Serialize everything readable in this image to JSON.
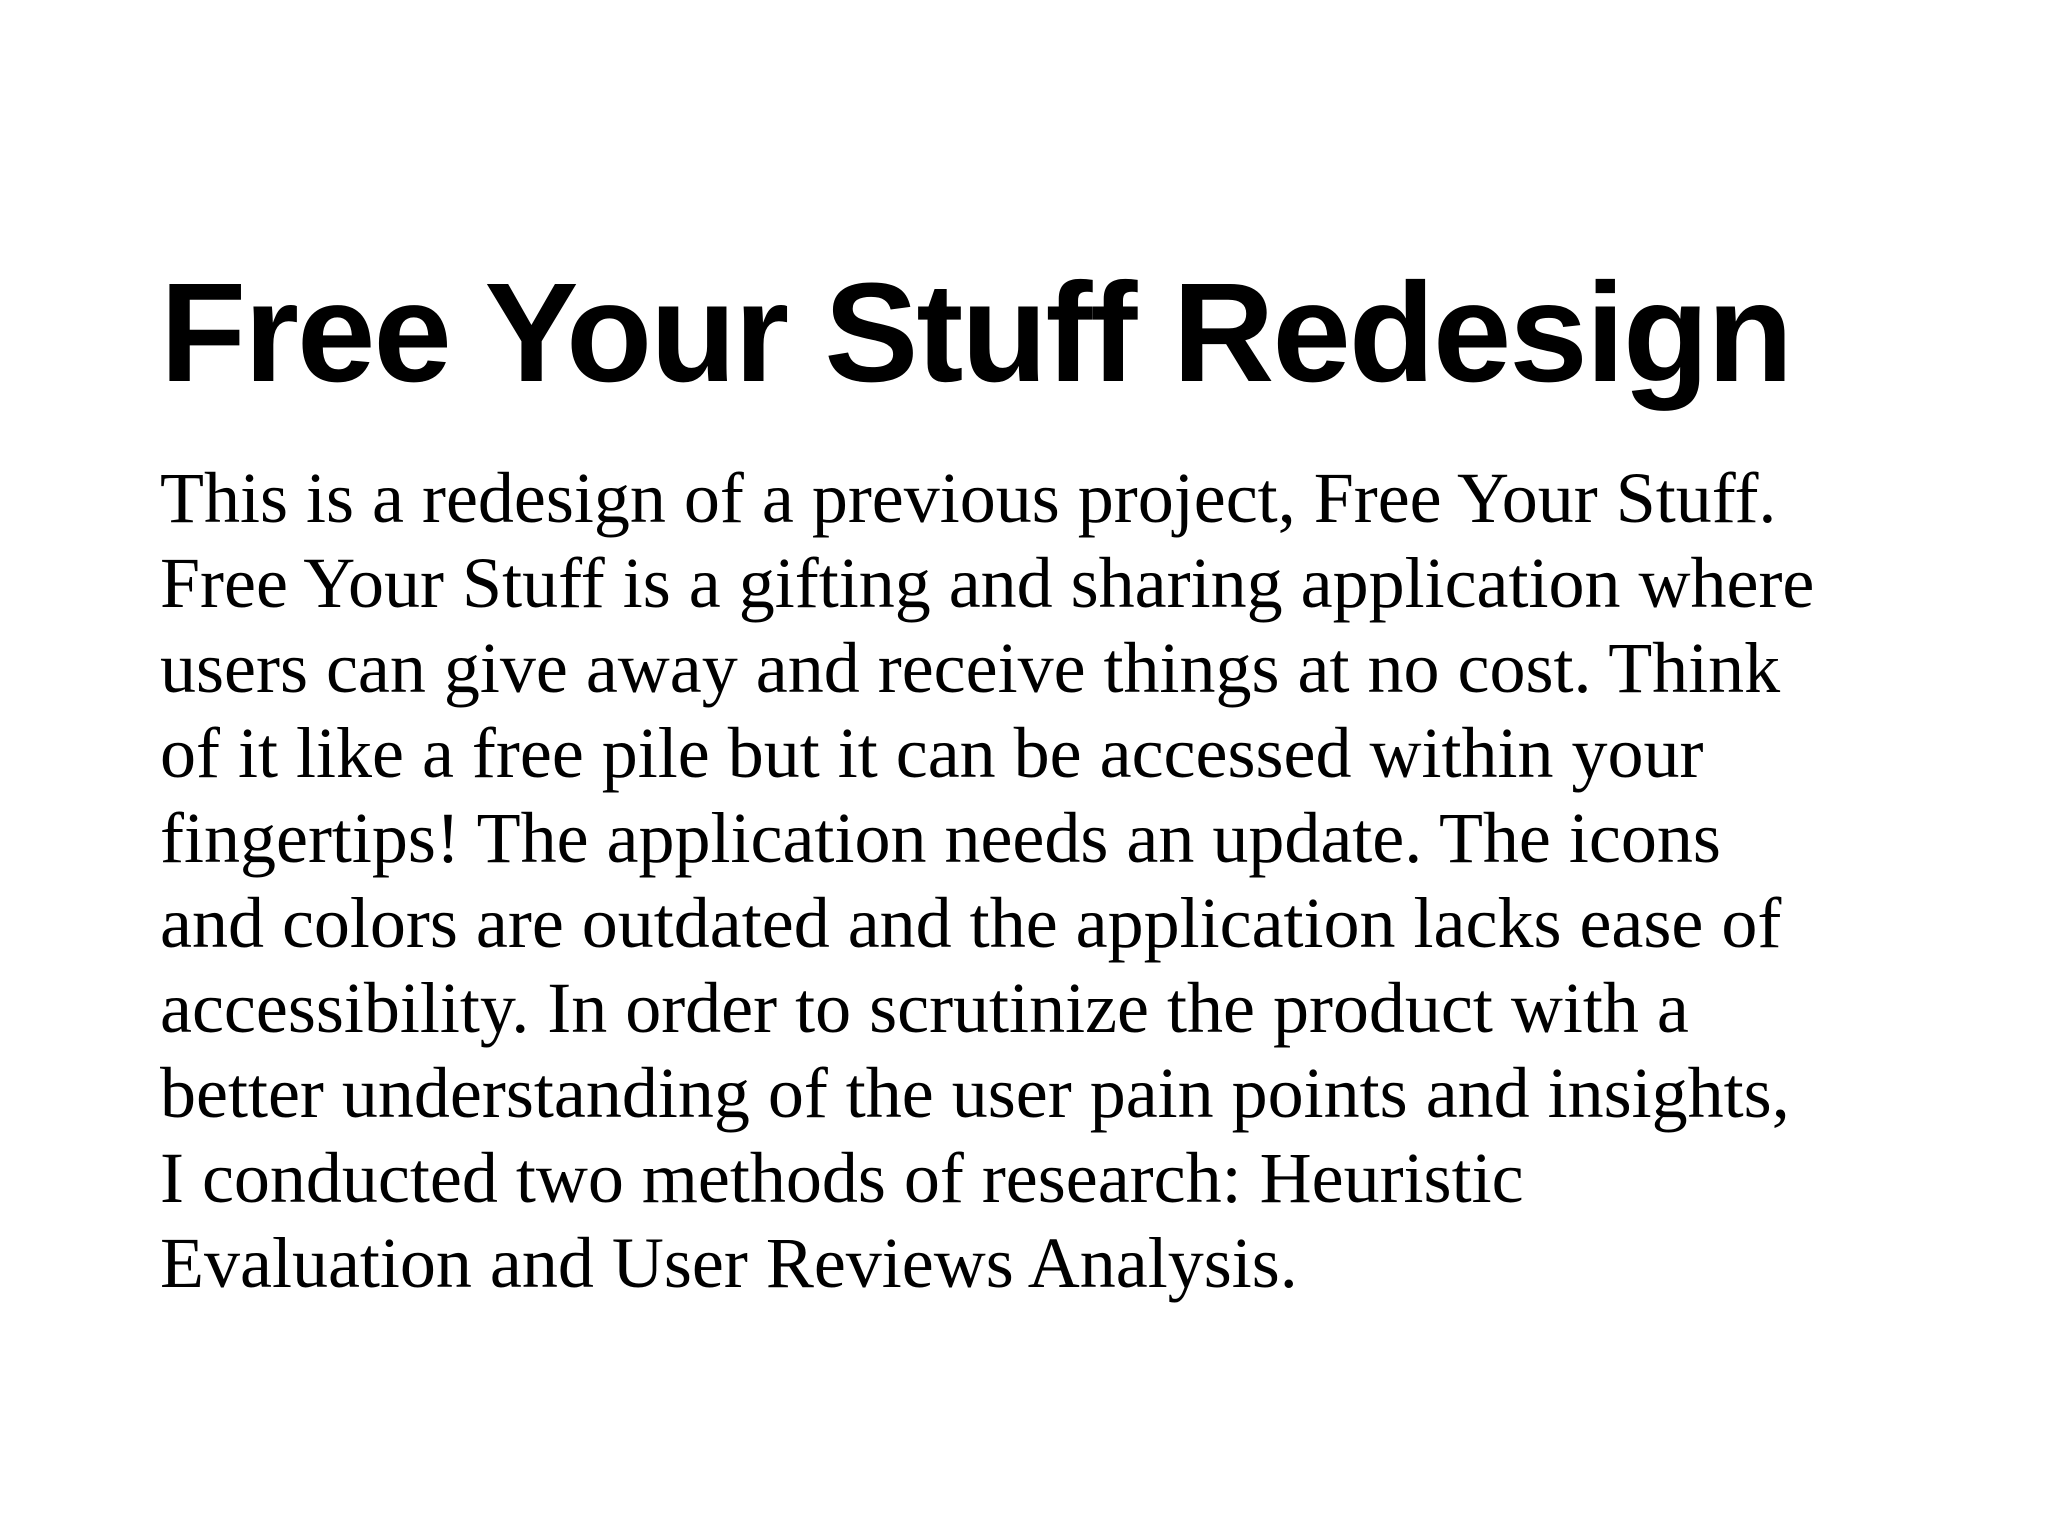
{
  "slide": {
    "title": "Free Your Stuff Redesign",
    "body_lines": [
      "This is a redesign of a previous project, Free Your Stuff.",
      "Free Your Stuff is a gifting and sharing application where",
      "users can give away and receive things at no cost. Think",
      "of it like a free pile but it can be accessed within your",
      "fingertips! The application needs an update. The icons",
      "and colors are outdated and the application lacks ease of",
      "accessibility. In order to scrutinize the product with a",
      "better understanding of the user pain points and insights,",
      "I conducted two methods of research: Heuristic",
      "Evaluation and User Reviews Analysis."
    ]
  }
}
